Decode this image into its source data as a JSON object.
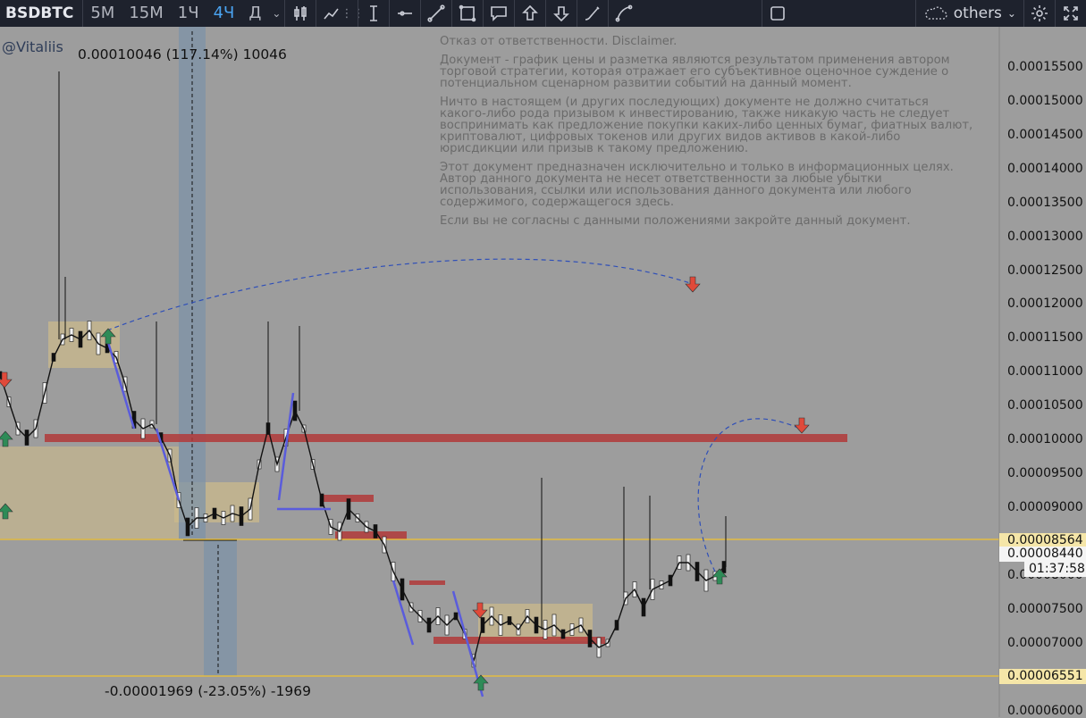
{
  "toolbar": {
    "symbol": "BSDBTC",
    "timeframes": [
      {
        "label": "5M",
        "active": false
      },
      {
        "label": "15M",
        "active": false
      },
      {
        "label": "1Ч",
        "active": false
      },
      {
        "label": "4Ч",
        "active": true
      },
      {
        "label": "Д",
        "active": false
      }
    ],
    "others_label": "others",
    "tools": [
      "text-cursor-icon",
      "horizontal-line-icon",
      "trend-line-icon",
      "rectangle-icon",
      "callout-icon",
      "arrow-up-icon",
      "arrow-down-icon",
      "brush-icon",
      "curve-icon"
    ]
  },
  "watermark": "@Vitaliis",
  "measure_top": "0.00010046 (117.14%) 10046",
  "measure_bottom": "-0.00001969 (-23.05%) -1969",
  "disclaimer": [
    "Отказ от ответственности. Disclaimer.",
    "Документ - график цены и разметка являются результатом применения автором торговой стратегии, которая отражает его субъективное оценочное суждение о потенциальном сценарном развитии событий на данный момент.",
    "Ничто в настоящем (и других последующих) документе не должно считаться какого-либо рода призывом к инвестированию, также никакую часть не следует воспринимать как предложение покупки каких-либо ценных бумаг, фиатных валют, криптовалют, цифровых токенов или других видов активов в какой-либо юрисдикции или призыв к такому предложению.",
    "Этот документ предназначен исключительно и только в информационных целях. Автор данного документа не несет ответственности за любые убытки использования, ссылки или использования данного документа или любого содержимого, содержащегося здесь.",
    "Если вы не согласны с данными положениями закройте данный документ."
  ],
  "price_axis": {
    "labels": [
      "0.00015500",
      "0.00015000",
      "0.00014500",
      "0.00014000",
      "0.00013500",
      "0.00013000",
      "0.00012500",
      "0.00012000",
      "0.00011500",
      "0.00011000",
      "0.00010500",
      "0.00010000",
      "0.00009500",
      "0.00009000",
      "0.00008000",
      "0.00007500",
      "0.00007000",
      "0.00006000"
    ],
    "values": [
      15500,
      15000,
      14500,
      14000,
      13500,
      13000,
      12500,
      12000,
      11500,
      11000,
      10500,
      10000,
      9500,
      9000,
      8000,
      7500,
      7000,
      6000
    ],
    "line_tag_high": "0.00008564",
    "current_price": "0.00008440",
    "countdown": "01:37:58",
    "line_tag_low": "0.00006551",
    "colors": {
      "hline": "#f2c230",
      "tag_bg": "#f5e6a8",
      "red_zone": "#b23a3a",
      "sand_zone": "#cdbb8a",
      "blue_zone": "#7d93a8",
      "trend": "#5a5cdc",
      "arrow_red": "#e04a3a",
      "arrow_green": "#2e8b57"
    }
  }
}
